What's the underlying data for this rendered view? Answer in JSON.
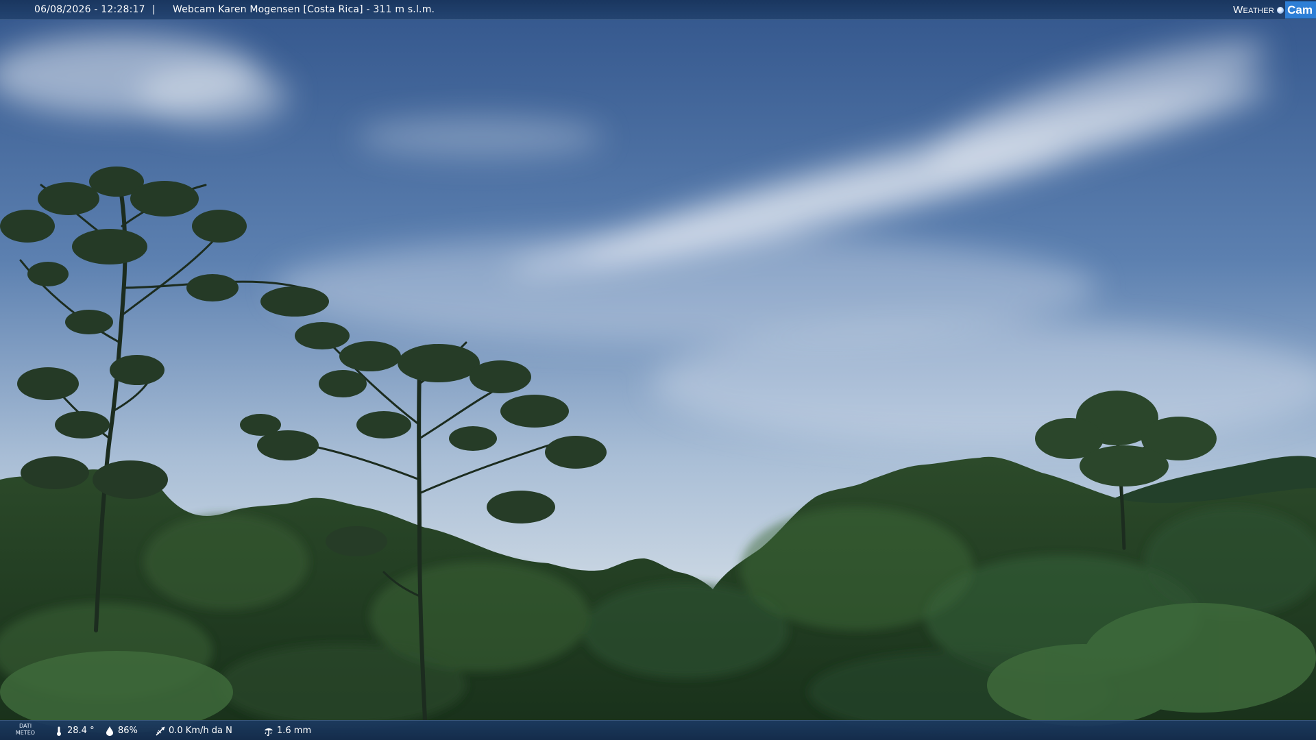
{
  "header": {
    "datetime": "06/08/2026 - 12:28:17",
    "separator": "|",
    "title": "Webcam Karen Mogensen [Costa Rica]  - 311 m s.l.m."
  },
  "logo": {
    "weather": "Weather",
    "cam": "Cam"
  },
  "weather_bar": {
    "label_line1": "DATI",
    "label_line2": "METEO",
    "temperature": "28.4 °",
    "humidity": "86%",
    "wind": "0.0 Km/h da N",
    "rain": "1.6 mm"
  },
  "colors": {
    "bar_background": "#1d3a63",
    "sky_top": "#3a5f96",
    "sky_horizon": "#c9d6e3",
    "forest": "#1f3a1f",
    "cam_badge": "#2e7fd6"
  }
}
